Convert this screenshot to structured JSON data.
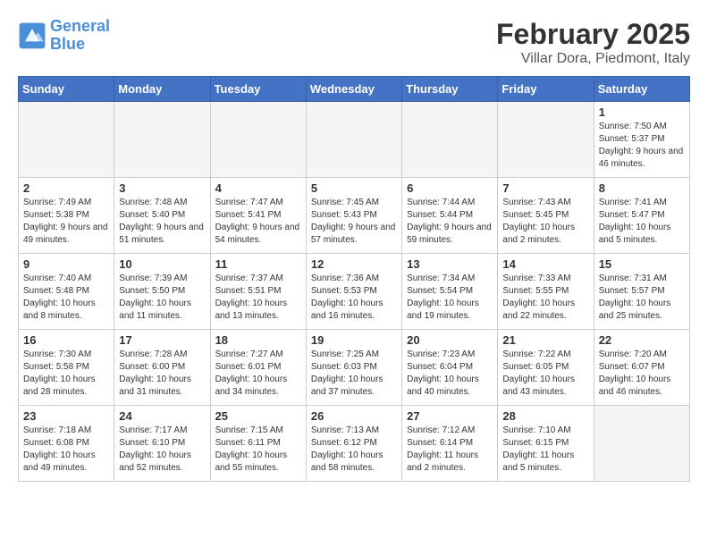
{
  "header": {
    "logo_line1": "General",
    "logo_line2": "Blue",
    "month": "February 2025",
    "location": "Villar Dora, Piedmont, Italy"
  },
  "weekdays": [
    "Sunday",
    "Monday",
    "Tuesday",
    "Wednesday",
    "Thursday",
    "Friday",
    "Saturday"
  ],
  "weeks": [
    [
      {
        "day": "",
        "info": "",
        "empty": true
      },
      {
        "day": "",
        "info": "",
        "empty": true
      },
      {
        "day": "",
        "info": "",
        "empty": true
      },
      {
        "day": "",
        "info": "",
        "empty": true
      },
      {
        "day": "",
        "info": "",
        "empty": true
      },
      {
        "day": "",
        "info": "",
        "empty": true
      },
      {
        "day": "1",
        "info": "Sunrise: 7:50 AM\nSunset: 5:37 PM\nDaylight: 9 hours and 46 minutes.",
        "empty": false
      }
    ],
    [
      {
        "day": "2",
        "info": "Sunrise: 7:49 AM\nSunset: 5:38 PM\nDaylight: 9 hours and 49 minutes.",
        "empty": false
      },
      {
        "day": "3",
        "info": "Sunrise: 7:48 AM\nSunset: 5:40 PM\nDaylight: 9 hours and 51 minutes.",
        "empty": false
      },
      {
        "day": "4",
        "info": "Sunrise: 7:47 AM\nSunset: 5:41 PM\nDaylight: 9 hours and 54 minutes.",
        "empty": false
      },
      {
        "day": "5",
        "info": "Sunrise: 7:45 AM\nSunset: 5:43 PM\nDaylight: 9 hours and 57 minutes.",
        "empty": false
      },
      {
        "day": "6",
        "info": "Sunrise: 7:44 AM\nSunset: 5:44 PM\nDaylight: 9 hours and 59 minutes.",
        "empty": false
      },
      {
        "day": "7",
        "info": "Sunrise: 7:43 AM\nSunset: 5:45 PM\nDaylight: 10 hours and 2 minutes.",
        "empty": false
      },
      {
        "day": "8",
        "info": "Sunrise: 7:41 AM\nSunset: 5:47 PM\nDaylight: 10 hours and 5 minutes.",
        "empty": false
      }
    ],
    [
      {
        "day": "9",
        "info": "Sunrise: 7:40 AM\nSunset: 5:48 PM\nDaylight: 10 hours and 8 minutes.",
        "empty": false
      },
      {
        "day": "10",
        "info": "Sunrise: 7:39 AM\nSunset: 5:50 PM\nDaylight: 10 hours and 11 minutes.",
        "empty": false
      },
      {
        "day": "11",
        "info": "Sunrise: 7:37 AM\nSunset: 5:51 PM\nDaylight: 10 hours and 13 minutes.",
        "empty": false
      },
      {
        "day": "12",
        "info": "Sunrise: 7:36 AM\nSunset: 5:53 PM\nDaylight: 10 hours and 16 minutes.",
        "empty": false
      },
      {
        "day": "13",
        "info": "Sunrise: 7:34 AM\nSunset: 5:54 PM\nDaylight: 10 hours and 19 minutes.",
        "empty": false
      },
      {
        "day": "14",
        "info": "Sunrise: 7:33 AM\nSunset: 5:55 PM\nDaylight: 10 hours and 22 minutes.",
        "empty": false
      },
      {
        "day": "15",
        "info": "Sunrise: 7:31 AM\nSunset: 5:57 PM\nDaylight: 10 hours and 25 minutes.",
        "empty": false
      }
    ],
    [
      {
        "day": "16",
        "info": "Sunrise: 7:30 AM\nSunset: 5:58 PM\nDaylight: 10 hours and 28 minutes.",
        "empty": false
      },
      {
        "day": "17",
        "info": "Sunrise: 7:28 AM\nSunset: 6:00 PM\nDaylight: 10 hours and 31 minutes.",
        "empty": false
      },
      {
        "day": "18",
        "info": "Sunrise: 7:27 AM\nSunset: 6:01 PM\nDaylight: 10 hours and 34 minutes.",
        "empty": false
      },
      {
        "day": "19",
        "info": "Sunrise: 7:25 AM\nSunset: 6:03 PM\nDaylight: 10 hours and 37 minutes.",
        "empty": false
      },
      {
        "day": "20",
        "info": "Sunrise: 7:23 AM\nSunset: 6:04 PM\nDaylight: 10 hours and 40 minutes.",
        "empty": false
      },
      {
        "day": "21",
        "info": "Sunrise: 7:22 AM\nSunset: 6:05 PM\nDaylight: 10 hours and 43 minutes.",
        "empty": false
      },
      {
        "day": "22",
        "info": "Sunrise: 7:20 AM\nSunset: 6:07 PM\nDaylight: 10 hours and 46 minutes.",
        "empty": false
      }
    ],
    [
      {
        "day": "23",
        "info": "Sunrise: 7:18 AM\nSunset: 6:08 PM\nDaylight: 10 hours and 49 minutes.",
        "empty": false
      },
      {
        "day": "24",
        "info": "Sunrise: 7:17 AM\nSunset: 6:10 PM\nDaylight: 10 hours and 52 minutes.",
        "empty": false
      },
      {
        "day": "25",
        "info": "Sunrise: 7:15 AM\nSunset: 6:11 PM\nDaylight: 10 hours and 55 minutes.",
        "empty": false
      },
      {
        "day": "26",
        "info": "Sunrise: 7:13 AM\nSunset: 6:12 PM\nDaylight: 10 hours and 58 minutes.",
        "empty": false
      },
      {
        "day": "27",
        "info": "Sunrise: 7:12 AM\nSunset: 6:14 PM\nDaylight: 11 hours and 2 minutes.",
        "empty": false
      },
      {
        "day": "28",
        "info": "Sunrise: 7:10 AM\nSunset: 6:15 PM\nDaylight: 11 hours and 5 minutes.",
        "empty": false
      },
      {
        "day": "",
        "info": "",
        "empty": true
      }
    ]
  ]
}
